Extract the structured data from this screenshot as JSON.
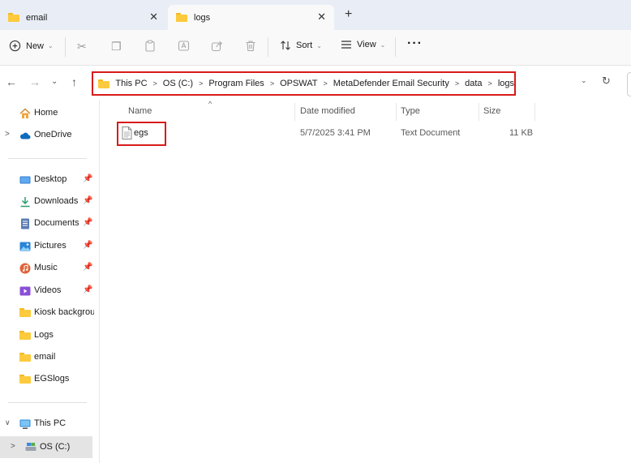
{
  "tabs": [
    {
      "label": "email",
      "active": false
    },
    {
      "label": "logs",
      "active": true
    }
  ],
  "toolbar": {
    "new_label": "New",
    "sort_label": "Sort",
    "view_label": "View",
    "more_label": "···"
  },
  "address": {
    "crumbs": [
      "This PC",
      "OS (C:)",
      "Program Files",
      "OPSWAT",
      "MetaDefender Email Security",
      "data",
      "logs"
    ]
  },
  "sidebar": {
    "home": "Home",
    "onedrive": "OneDrive",
    "quick": [
      {
        "label": "Desktop",
        "pinned": true,
        "icon": "desktop-icon"
      },
      {
        "label": "Downloads",
        "pinned": true,
        "icon": "download-icon"
      },
      {
        "label": "Documents",
        "pinned": true,
        "icon": "document-icon"
      },
      {
        "label": "Pictures",
        "pinned": true,
        "icon": "picture-icon"
      },
      {
        "label": "Music",
        "pinned": true,
        "icon": "music-icon"
      },
      {
        "label": "Videos",
        "pinned": true,
        "icon": "video-icon"
      },
      {
        "label": "Kiosk backgrour",
        "pinned": false,
        "icon": "folder-icon"
      },
      {
        "label": "Logs",
        "pinned": false,
        "icon": "folder-icon"
      },
      {
        "label": "email",
        "pinned": false,
        "icon": "folder-icon"
      },
      {
        "label": "EGSlogs",
        "pinned": false,
        "icon": "folder-icon"
      }
    ],
    "thispc": "This PC",
    "drive": "OS (C:)"
  },
  "columns": {
    "name": "Name",
    "date": "Date modified",
    "type": "Type",
    "size": "Size"
  },
  "files": [
    {
      "name": "egs",
      "date": "5/7/2025 3:41 PM",
      "type": "Text Document",
      "size": "11 KB"
    }
  ],
  "colors": {
    "highlight": "#d81b1b",
    "folder": "#fcca3c",
    "tabstrip": "#e9eef6"
  }
}
